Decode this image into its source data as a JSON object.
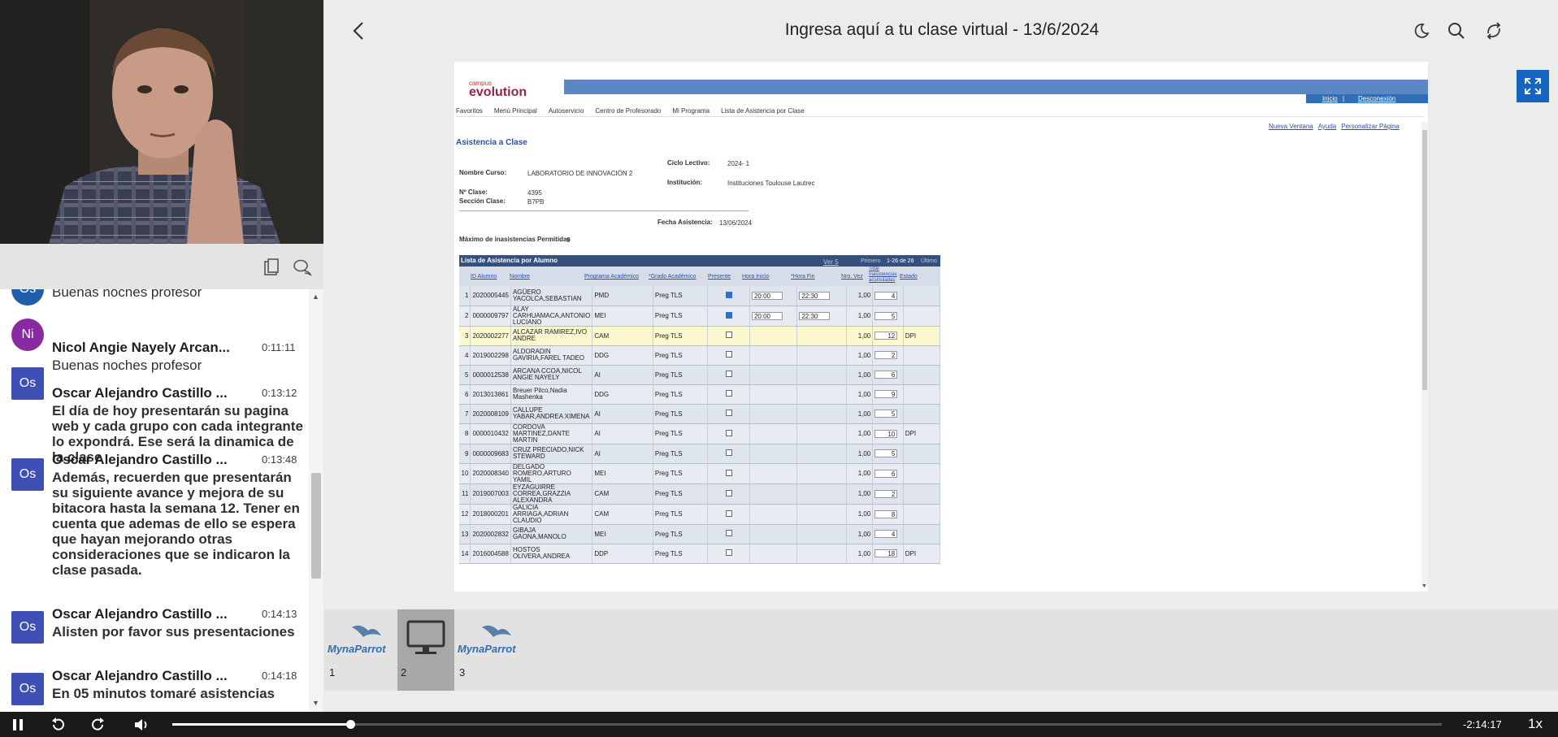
{
  "window": {
    "title": "Ingresa aquí a tu clase virtual - 13/6/2024"
  },
  "chat": {
    "messages": [
      {
        "initials": "Ni",
        "name": "Nicol Angie Nayely Arcan...",
        "time": "0:11:11",
        "text": "Buenas noches profesor"
      },
      {
        "initials": "Os",
        "name": "Oscar Alejandro Castillo ...",
        "time": "0:13:12",
        "text": "El día de hoy presentarán su pagina web y cada grupo con cada integrante lo expondrá. Ese será la dinamica de la clase"
      },
      {
        "initials": "Os",
        "name": "Oscar Alejandro Castillo ...",
        "time": "0:13:48",
        "text": "Además, recuerden que presentarán su siguiente avance y mejora de su bitacora hasta la semana 12. Tener en cuenta que ademas de ello se espera que hayan mejorando otras consideraciones que se indicaron la clase pasada."
      },
      {
        "initials": "Os",
        "name": "Oscar Alejandro Castillo ...",
        "time": "0:14:13",
        "text": "Alisten por favor sus presentaciones"
      },
      {
        "initials": "Os",
        "name": "Oscar Alejandro Castillo ...",
        "time": "0:14:18",
        "text": "En 05 minutos tomaré asistencias"
      }
    ],
    "partial": {
      "initials": "Os",
      "text": "Buenas noches profesor"
    }
  },
  "document": {
    "brand_top": "campus",
    "brand": "evolution",
    "links_top": [
      "Inicio",
      "Desconexión"
    ],
    "breadcrumb": [
      "Favoritos",
      "Menú Principal",
      "Autoservicio",
      "Centro de Profesorado",
      "Mi Programa",
      "Lista de Asistencia por Clase"
    ],
    "links_right": [
      "Nueva Ventana",
      "Ayuda",
      "Personalizar Página"
    ],
    "heading": "Asistencia a Clase",
    "course_label": "Nombre Curso:",
    "course": "LABORATORIO DE INNOVACIÓN 2",
    "cycle_label": "Ciclo Lectivo:",
    "cycle": "2024- 1",
    "inst_label": "Institución:",
    "inst": "Instituciones Toulouse Lautrec",
    "class_label": "Nº Clase:",
    "class_no": "4395",
    "section_label": "Sección Clase:",
    "section": "B7PB",
    "date_label": "Fecha Asistencia:",
    "date": "13/06/2024",
    "max_label": "Máximo de inasistencias Permitidas",
    "max": "9",
    "list_title": "Lista de Asistencia por Alumno",
    "pager": {
      "view": "Ver 5",
      "first": "Primero",
      "range": "1-26 de 26",
      "last": "Último"
    },
    "columns": [
      "ID Alumno",
      "Nombre",
      "Programa Académico",
      "*Grado Académico",
      "Presente",
      "Hora Inicio",
      "*Hora Fin",
      "Nro. Vez",
      "Total Inasistencias acumuladas",
      "Estado"
    ],
    "rows": [
      {
        "n": "1",
        "id": "2020005445",
        "name": "AGÜERO YACOLCA,SEBASTIAN",
        "prog": "PMD",
        "grado": "Preg TLS",
        "present": true,
        "ini": "20:00",
        "fin": "22:30",
        "vez": "1,00",
        "total": "4",
        "estado": ""
      },
      {
        "n": "2",
        "id": "0000009797",
        "name": "ALAY CARHUAMACA,ANTONIO LUCIANO",
        "prog": "MEI",
        "grado": "Preg TLS",
        "present": true,
        "ini": "20:00",
        "fin": "22:30",
        "vez": "1,00",
        "total": "5",
        "estado": ""
      },
      {
        "n": "3",
        "id": "2020002277",
        "name": "ALCAZAR RAMIREZ,IVO ANDRE",
        "prog": "CAM",
        "grado": "Preg TLS",
        "present": false,
        "ini": "",
        "fin": "",
        "vez": "1,00",
        "total": "12",
        "estado": "DPI"
      },
      {
        "n": "4",
        "id": "2019002298",
        "name": "ALDORADIN GAVIRIA,FAREL TADEO",
        "prog": "DDG",
        "grado": "Preg TLS",
        "present": false,
        "ini": "",
        "fin": "",
        "vez": "1,00",
        "total": "2",
        "estado": ""
      },
      {
        "n": "5",
        "id": "0000012538",
        "name": "ARCANA CCOA,NICOL ANGIE NAYELY",
        "prog": "AI",
        "grado": "Preg TLS",
        "present": false,
        "ini": "",
        "fin": "",
        "vez": "1,00",
        "total": "6",
        "estado": ""
      },
      {
        "n": "6",
        "id": "2013013861",
        "name": "Breuer Pilco,Nadia Mashenka",
        "prog": "DDG",
        "grado": "Preg TLS",
        "present": false,
        "ini": "",
        "fin": "",
        "vez": "1,00",
        "total": "9",
        "estado": ""
      },
      {
        "n": "7",
        "id": "2020008109",
        "name": "CALLUPE YABAR,ANDREA XIMENA",
        "prog": "AI",
        "grado": "Preg TLS",
        "present": false,
        "ini": "",
        "fin": "",
        "vez": "1,00",
        "total": "5",
        "estado": ""
      },
      {
        "n": "8",
        "id": "0000010432",
        "name": "CORDOVA MARTINEZ,DANTE MARTIN",
        "prog": "AI",
        "grado": "Preg TLS",
        "present": false,
        "ini": "",
        "fin": "",
        "vez": "1,00",
        "total": "10",
        "estado": "DPI"
      },
      {
        "n": "9",
        "id": "0000009683",
        "name": "CRUZ PRECIADO,NICK STEWARD",
        "prog": "AI",
        "grado": "Preg TLS",
        "present": false,
        "ini": "",
        "fin": "",
        "vez": "1,00",
        "total": "5",
        "estado": ""
      },
      {
        "n": "10",
        "id": "2020008340",
        "name": "DELGADO ROMERO,ARTURO YAMIL",
        "prog": "MEI",
        "grado": "Preg TLS",
        "present": false,
        "ini": "",
        "fin": "",
        "vez": "1,00",
        "total": "6",
        "estado": ""
      },
      {
        "n": "11",
        "id": "2019007003",
        "name": "EYZAGUIRRE CORREA,GRAZZIA ALEXANDRA",
        "prog": "CAM",
        "grado": "Preg TLS",
        "present": false,
        "ini": "",
        "fin": "",
        "vez": "1,00",
        "total": "2",
        "estado": ""
      },
      {
        "n": "12",
        "id": "2018000201",
        "name": "GALICIA ARRIAGA,ADRIAN CLAUDIO",
        "prog": "CAM",
        "grado": "Preg TLS",
        "present": false,
        "ini": "",
        "fin": "",
        "vez": "1,00",
        "total": "8",
        "estado": ""
      },
      {
        "n": "13",
        "id": "2020002832",
        "name": "GIBAJA GAONA,MANOLO",
        "prog": "MEI",
        "grado": "Preg TLS",
        "present": false,
        "ini": "",
        "fin": "",
        "vez": "1,00",
        "total": "4",
        "estado": ""
      },
      {
        "n": "14",
        "id": "2016004588",
        "name": "HOSTOS OLIVERA,ANDREA",
        "prog": "DDP",
        "grado": "Preg TLS",
        "present": false,
        "ini": "",
        "fin": "",
        "vez": "1,00",
        "total": "18",
        "estado": "DPI"
      }
    ]
  },
  "thumbnails": [
    {
      "num": "1",
      "logo": "MynaParrot"
    },
    {
      "num": "2",
      "logo": ""
    },
    {
      "num": "3",
      "logo": "MynaParrot"
    }
  ],
  "player": {
    "remaining": "-2:14:17",
    "speed": "1x",
    "progress": 0.14
  }
}
